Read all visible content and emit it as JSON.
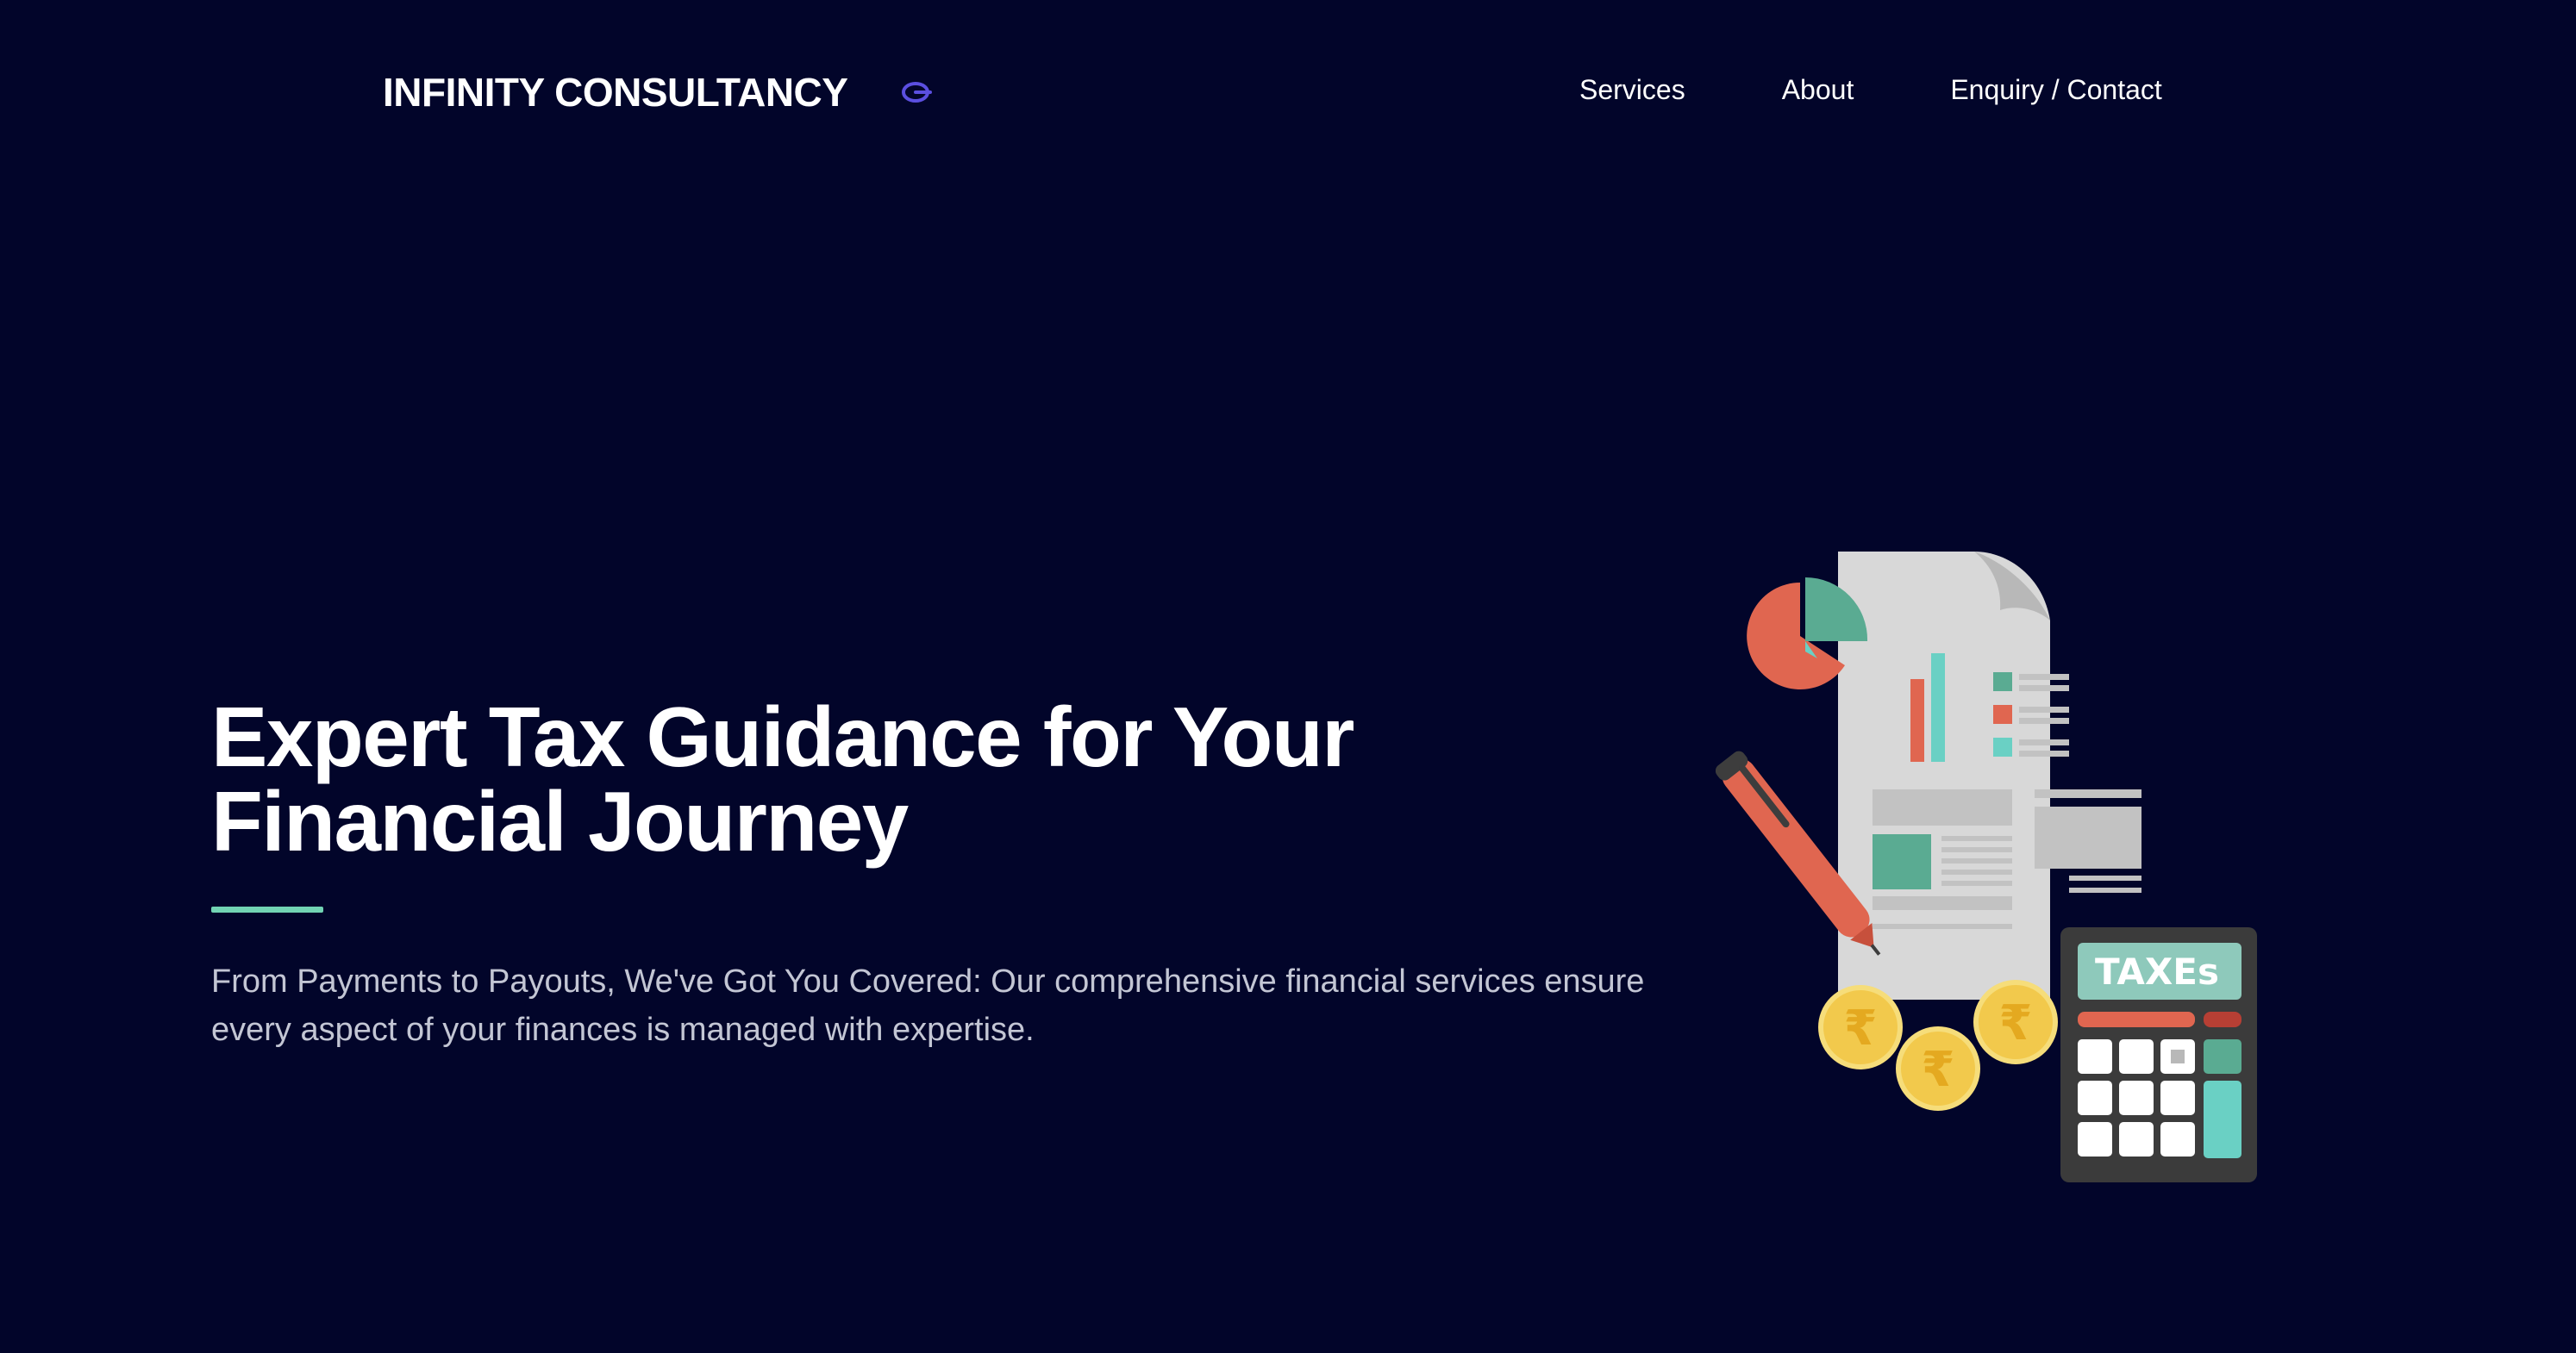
{
  "header": {
    "brand_name": "INFINITY CONSULTANCY",
    "brand_icon": "infinity-ring-icon",
    "nav": [
      {
        "label": "Services"
      },
      {
        "label": "About"
      },
      {
        "label": "Enquiry / Contact"
      }
    ]
  },
  "hero": {
    "title": "Expert Tax Guidance for Your Financial Journey",
    "subtitle": "From Payments to Payouts, We've Got You Covered: Our comprehensive financial services ensure every aspect of your finances is managed with expertise.",
    "illustration": {
      "calculator_label": "TAXEs",
      "coin_symbol": "₹"
    }
  },
  "colors": {
    "background": "#02052a",
    "accent": "#72d4b4",
    "text": "#ffffff",
    "muted_text": "#c3c6d4",
    "brand_icon": "#5b4fe0"
  }
}
